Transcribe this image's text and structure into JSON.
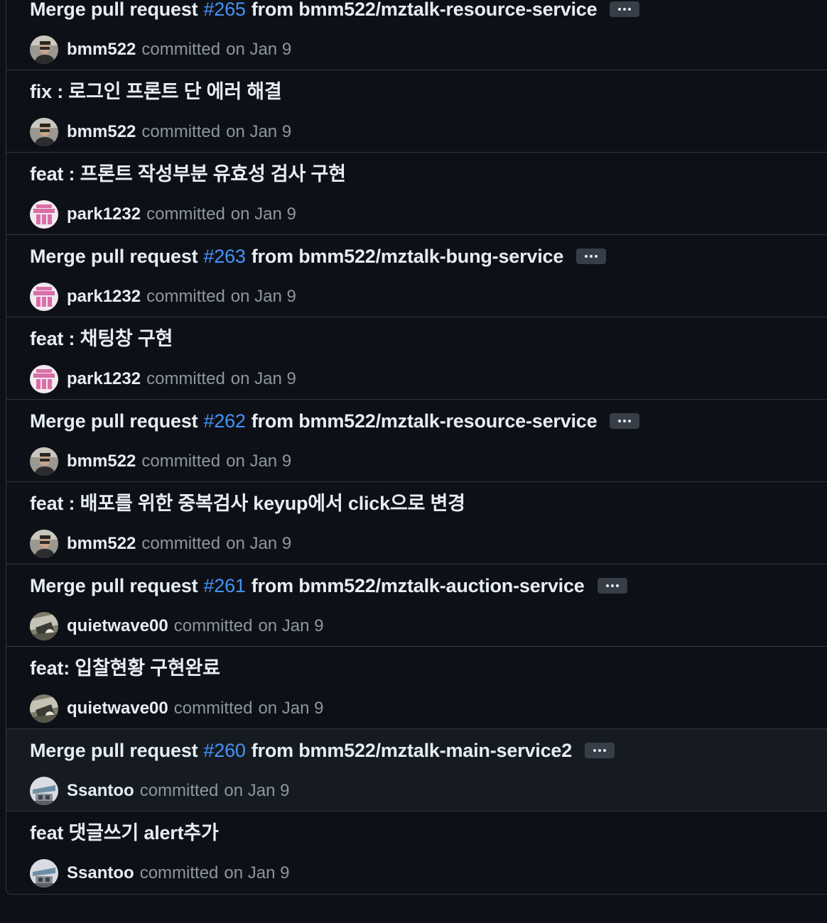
{
  "commits": [
    {
      "prefix": "Merge pull request",
      "pr_number": "#265",
      "suffix": "from bmm522/mztalk-resource-service",
      "is_merge": true,
      "author": "bmm522",
      "avatar_icon": "bmm522-avatar-icon",
      "committed_label": "committed",
      "date": "on Jan 9"
    },
    {
      "message": "fix : 로그인 프론트 단 에러 해결",
      "is_merge": false,
      "author": "bmm522",
      "avatar_icon": "bmm522-avatar-icon",
      "committed_label": "committed",
      "date": "on Jan 9"
    },
    {
      "message": "feat : 프론트 작성부분 유효성 검사 구현",
      "is_merge": false,
      "author": "park1232",
      "avatar_icon": "park1232-avatar-icon",
      "committed_label": "committed",
      "date": "on Jan 9"
    },
    {
      "prefix": "Merge pull request",
      "pr_number": "#263",
      "suffix": "from bmm522/mztalk-bung-service",
      "is_merge": true,
      "author": "park1232",
      "avatar_icon": "park1232-avatar-icon",
      "committed_label": "committed",
      "date": "on Jan 9"
    },
    {
      "message": "feat : 채팅창 구현",
      "is_merge": false,
      "author": "park1232",
      "avatar_icon": "park1232-avatar-icon",
      "committed_label": "committed",
      "date": "on Jan 9"
    },
    {
      "prefix": "Merge pull request",
      "pr_number": "#262",
      "suffix": "from bmm522/mztalk-resource-service",
      "is_merge": true,
      "author": "bmm522",
      "avatar_icon": "bmm522-avatar-icon",
      "committed_label": "committed",
      "date": "on Jan 9"
    },
    {
      "message": "feat : 배포를 위한 중복검사 keyup에서 click으로 변경",
      "is_merge": false,
      "author": "bmm522",
      "avatar_icon": "bmm522-avatar-icon",
      "committed_label": "committed",
      "date": "on Jan 9"
    },
    {
      "prefix": "Merge pull request",
      "pr_number": "#261",
      "suffix": "from bmm522/mztalk-auction-service",
      "is_merge": true,
      "author": "quietwave00",
      "avatar_icon": "quietwave00-avatar-icon",
      "committed_label": "committed",
      "date": "on Jan 9"
    },
    {
      "message": "feat: 입찰현황 구현완료",
      "is_merge": false,
      "author": "quietwave00",
      "avatar_icon": "quietwave00-avatar-icon",
      "committed_label": "committed",
      "date": "on Jan 9"
    },
    {
      "prefix": "Merge pull request",
      "pr_number": "#260",
      "suffix": "from bmm522/mztalk-main-service2",
      "is_merge": true,
      "hovered": true,
      "author": "Ssantoo",
      "avatar_icon": "ssantoo-avatar-icon",
      "committed_label": "committed",
      "date": "on Jan 9"
    },
    {
      "message": "feat 댓글쓰기 alert추가",
      "is_merge": false,
      "author": "Ssantoo",
      "avatar_icon": "ssantoo-avatar-icon",
      "committed_label": "committed",
      "date": "on Jan 9"
    }
  ],
  "colors": {
    "background": "#0d1117",
    "border": "#30363d",
    "link": "#4493f8",
    "text": "#e6edf3",
    "muted": "#8d96a0",
    "hover_row": "#161b22",
    "park_avatar": "#d86fa8"
  }
}
